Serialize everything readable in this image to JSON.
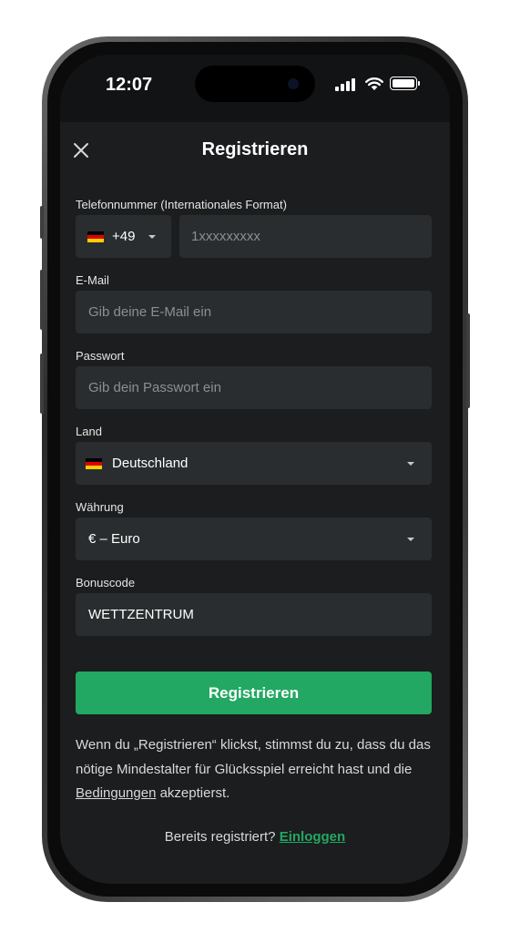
{
  "status_bar": {
    "time": "12:07"
  },
  "header": {
    "title": "Registrieren"
  },
  "form": {
    "phone": {
      "label": "Telefonnummer (Internationales Format)",
      "country_code": "+49",
      "placeholder": "1xxxxxxxxx"
    },
    "email": {
      "label": "E-Mail",
      "placeholder": "Gib deine E-Mail ein"
    },
    "password": {
      "label": "Passwort",
      "placeholder": "Gib dein Passwort ein"
    },
    "country": {
      "label": "Land",
      "value": "Deutschland"
    },
    "currency": {
      "label": "Währung",
      "value": "€ – Euro"
    },
    "bonus": {
      "label": "Bonuscode",
      "value": "WETTZENTRUM"
    }
  },
  "submit_label": "Registrieren",
  "terms": {
    "before": "Wenn du „Registrieren“ klickst, stimmst du zu, dass du das nötige Mindestalter für Glücksspiel erreicht hast und die ",
    "link": "Bedingungen",
    "after": " akzeptierst."
  },
  "login": {
    "prompt": "Bereits registriert?",
    "link": "Einloggen"
  },
  "colors": {
    "accent": "#22a862",
    "background": "#1b1d1e",
    "field": "#2a2d2f"
  },
  "icons": {
    "close": "close-icon",
    "dropdown": "chevron-down-icon",
    "flag": "germany-flag-icon"
  }
}
